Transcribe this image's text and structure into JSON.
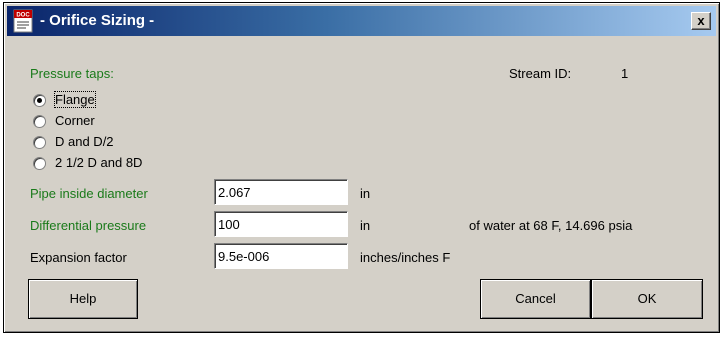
{
  "window": {
    "title": "- Orifice Sizing -",
    "close_label": "x",
    "icon_label": "DOC"
  },
  "pressure_taps": {
    "label": "Pressure taps:",
    "selected": "Flange",
    "options": [
      "Flange",
      "Corner",
      "D and D/2",
      "2 1/2 D and 8D"
    ]
  },
  "stream": {
    "label": "Stream ID:",
    "value": "1"
  },
  "fields": {
    "pipe_diameter": {
      "label": "Pipe inside diameter",
      "value": "2.067",
      "unit": "in"
    },
    "differential_pressure": {
      "label": "Differential pressure",
      "value": "100",
      "unit": "in",
      "note": "of  water at 68 F, 14.696 psia"
    },
    "expansion_factor": {
      "label": "Expansion factor",
      "value": "9.5e-006",
      "unit": "inches/inches F"
    }
  },
  "buttons": {
    "help": "Help",
    "cancel": "Cancel",
    "ok": "OK"
  },
  "colors": {
    "title_start": "#0a246a",
    "title_end": "#a6caf0",
    "label_green": "#1a7a1a",
    "dialog_face": "#d4d0c8"
  }
}
